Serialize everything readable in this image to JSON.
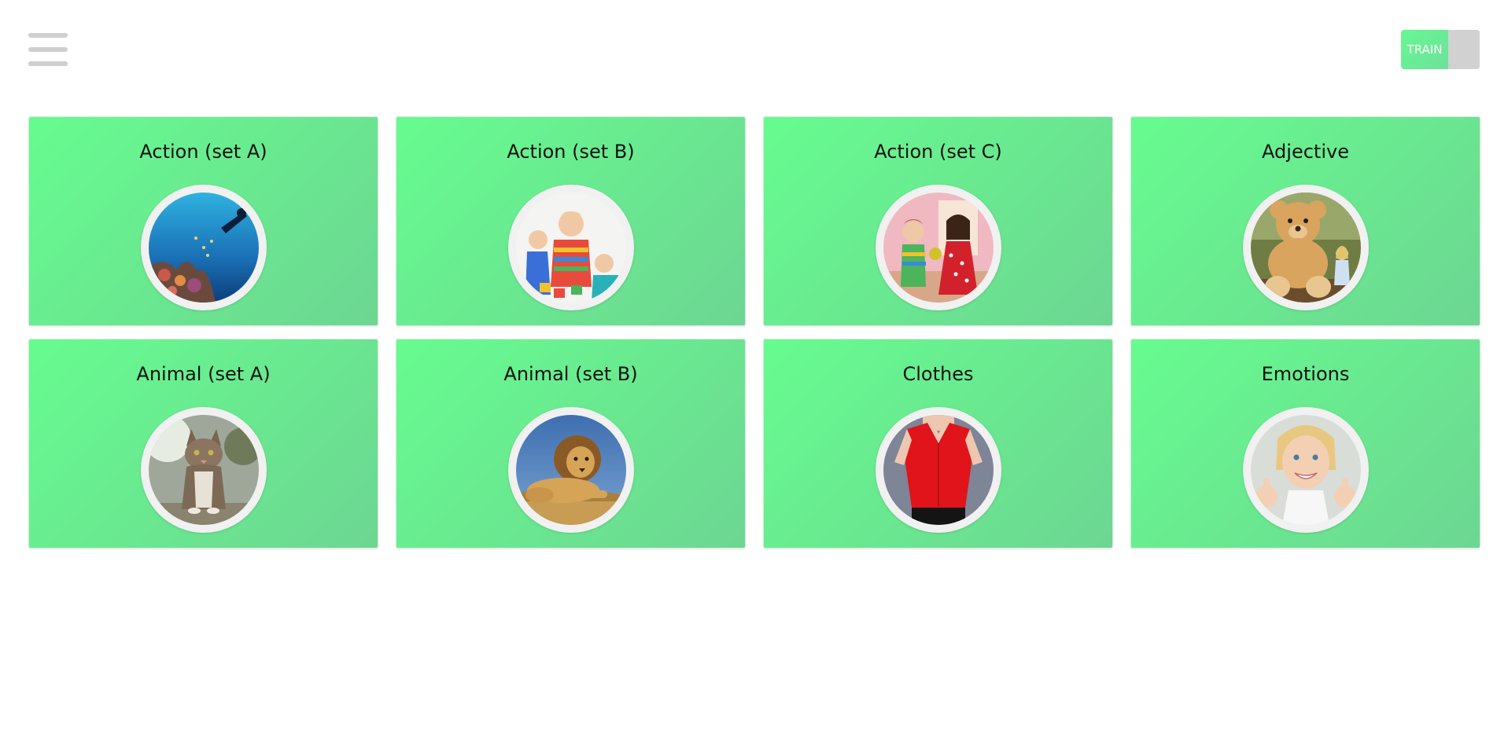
{
  "header": {
    "menu_icon": "hamburger-menu-icon",
    "train_toggle": {
      "label": "TRAIN",
      "state": "on",
      "on_color": "#66f793",
      "off_color": "#d1d1d1"
    }
  },
  "categories": [
    {
      "title": "Action (set A)",
      "image": "scuba-diver-coral-reef-photo"
    },
    {
      "title": "Action (set B)",
      "image": "children-playing-blocks-photo"
    },
    {
      "title": "Action (set C)",
      "image": "children-sharing-toy-photo"
    },
    {
      "title": "Adjective",
      "image": "giant-teddy-bear-girl-photo"
    },
    {
      "title": "Animal (set A)",
      "image": "sitting-cat-photo"
    },
    {
      "title": "Animal (set B)",
      "image": "lying-lion-photo"
    },
    {
      "title": "Clothes",
      "image": "red-blouse-photo"
    },
    {
      "title": "Emotions",
      "image": "smiling-girl-thumbs-up-photo"
    }
  ],
  "colors": {
    "card_gradient_start": "#66fc8f",
    "card_gradient_end": "#6dd692",
    "menu_icon": "#cfcfcf",
    "background": "#ffffff"
  }
}
